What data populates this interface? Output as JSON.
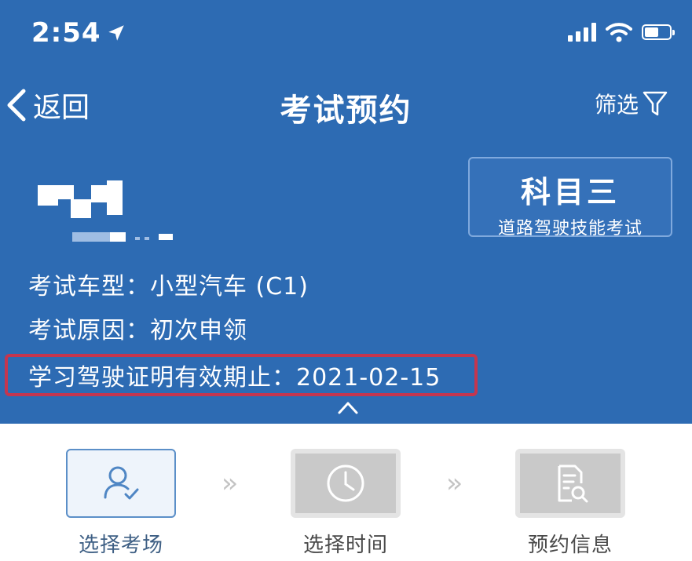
{
  "status_bar": {
    "time": "2:54",
    "battery_level": 0.55
  },
  "nav": {
    "back_label": "返回",
    "title": "考试预约",
    "filter_label": "筛选"
  },
  "subject": {
    "name": "科目三",
    "description": "道路驾驶技能考试"
  },
  "info": {
    "vehicle_type_label": "考试车型：",
    "vehicle_type_value": "小型汽车 (C1)",
    "reason_label": "考试原因：",
    "reason_value": "初次申领",
    "permit_label": "学习驾驶证明有效期止：",
    "permit_value": "2021-02-15"
  },
  "steps": [
    {
      "label": "选择考场",
      "icon": "user-check-icon",
      "active": true
    },
    {
      "label": "选择时间",
      "icon": "clock-icon",
      "active": false
    },
    {
      "label": "预约信息",
      "icon": "document-search-icon",
      "active": false
    }
  ],
  "colors": {
    "header_bg": "#2d6bb3",
    "highlight": "#c4364f",
    "active_step": "#5b8fc8"
  }
}
